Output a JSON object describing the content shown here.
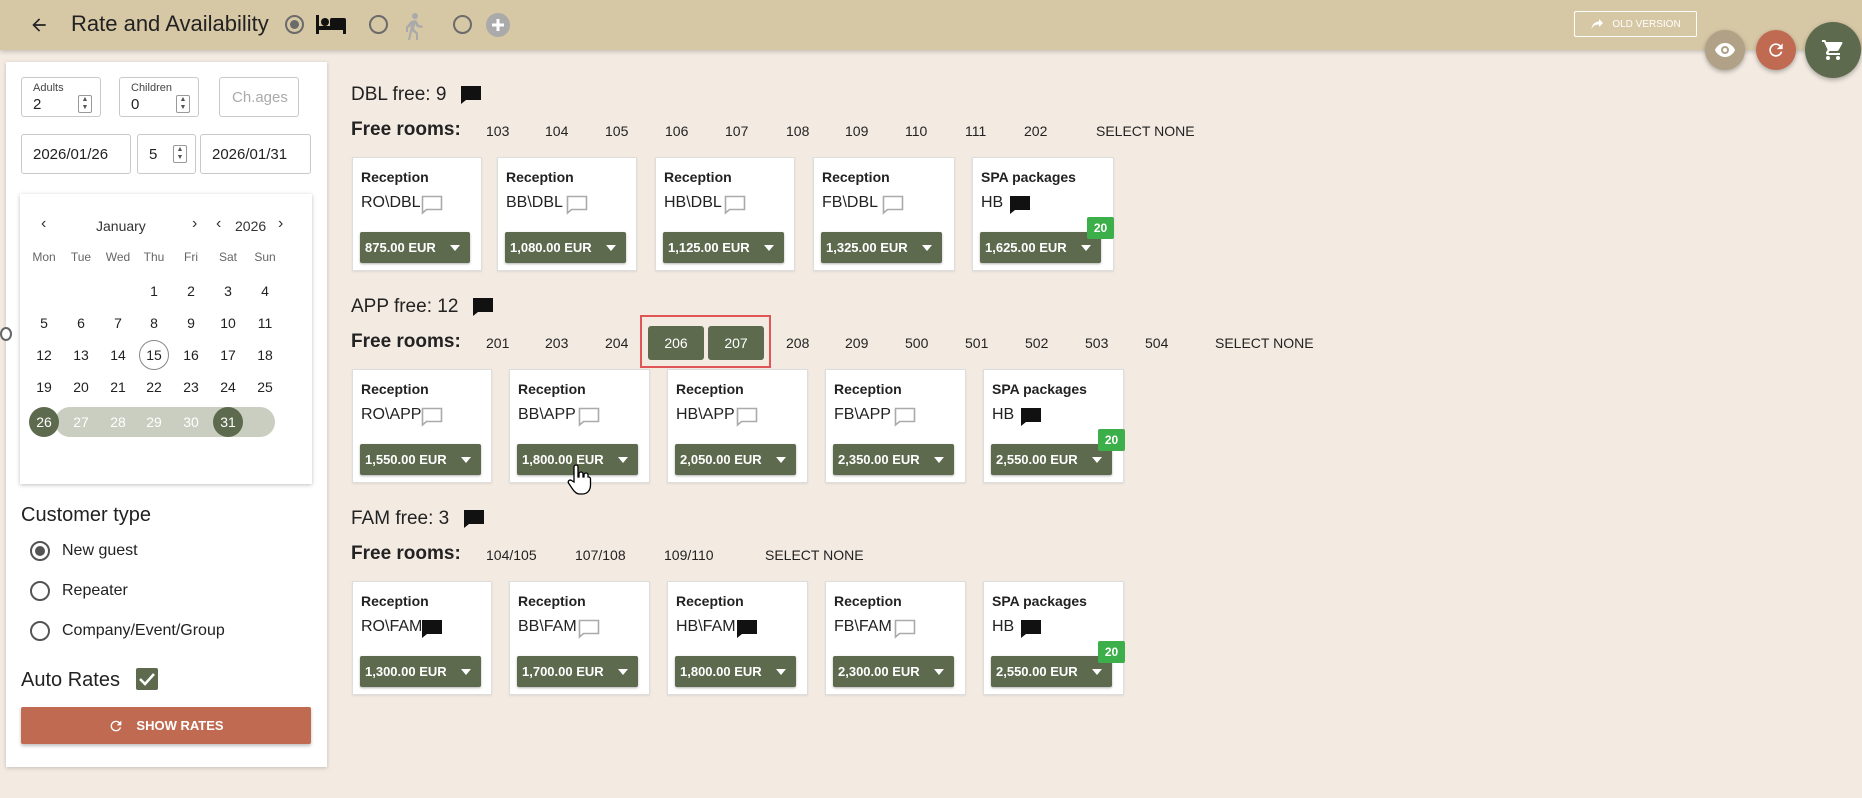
{
  "header": {
    "title": "Rate and Availability",
    "old_version_label": "OLD VERSION"
  },
  "search": {
    "adults_label": "Adults",
    "adults_value": "2",
    "children_label": "Children",
    "children_value": "0",
    "child_ages_placeholder": "Ch.ages",
    "arrival_date": "2026/01/26",
    "nights": "5",
    "departure_date": "2026/01/31"
  },
  "calendar": {
    "month": "January",
    "year": "2026",
    "weekdays": [
      "Mon",
      "Tue",
      "Wed",
      "Thu",
      "Fri",
      "Sat",
      "Sun"
    ],
    "today": "15",
    "range_start": "26",
    "range_end": "31"
  },
  "customer_type": {
    "title": "Customer type",
    "options": [
      "New guest",
      "Repeater",
      "Company/Event/Group"
    ],
    "selected": "New guest"
  },
  "auto_rates": {
    "label": "Auto Rates",
    "checked": true
  },
  "show_rates_label": "SHOW RATES",
  "free_rooms_label": "Free rooms:",
  "select_none_label": "SELECT NONE",
  "groups": [
    {
      "title": "DBL free: 9",
      "rooms": [
        "103",
        "104",
        "105",
        "106",
        "107",
        "108",
        "109",
        "110",
        "111",
        "202"
      ],
      "selected_rooms": [],
      "rates": [
        {
          "category": "Reception",
          "code": "RO\\DBL",
          "price": "875.00 EUR",
          "comment": "empty"
        },
        {
          "category": "Reception",
          "code": "BB\\DBL",
          "price": "1,080.00 EUR",
          "comment": "empty"
        },
        {
          "category": "Reception",
          "code": "HB\\DBL",
          "price": "1,125.00 EUR",
          "comment": "empty"
        },
        {
          "category": "Reception",
          "code": "FB\\DBL",
          "price": "1,325.00 EUR",
          "comment": "empty"
        },
        {
          "category": "SPA packages",
          "code": "HB",
          "price": "1,625.00 EUR",
          "comment": "filled",
          "badge": "20"
        }
      ]
    },
    {
      "title": "APP free: 12",
      "rooms": [
        "201",
        "203",
        "204",
        "206",
        "207",
        "208",
        "209",
        "500",
        "501",
        "502",
        "503",
        "504"
      ],
      "selected_rooms": [
        "206",
        "207"
      ],
      "rates": [
        {
          "category": "Reception",
          "code": "RO\\APP",
          "price": "1,550.00 EUR",
          "comment": "empty"
        },
        {
          "category": "Reception",
          "code": "BB\\APP",
          "price": "1,800.00 EUR",
          "comment": "empty"
        },
        {
          "category": "Reception",
          "code": "HB\\APP",
          "price": "2,050.00 EUR",
          "comment": "empty"
        },
        {
          "category": "Reception",
          "code": "FB\\APP",
          "price": "2,350.00 EUR",
          "comment": "empty"
        },
        {
          "category": "SPA packages",
          "code": "HB",
          "price": "2,550.00 EUR",
          "comment": "filled",
          "badge": "20"
        }
      ]
    },
    {
      "title": "FAM free: 3",
      "rooms": [
        "104/105",
        "107/108",
        "109/110"
      ],
      "selected_rooms": [],
      "rates": [
        {
          "category": "Reception",
          "code": "RO\\FAM",
          "price": "1,300.00 EUR",
          "comment": "filled"
        },
        {
          "category": "Reception",
          "code": "BB\\FAM",
          "price": "1,700.00 EUR",
          "comment": "empty"
        },
        {
          "category": "Reception",
          "code": "HB\\FAM",
          "price": "1,800.00 EUR",
          "comment": "filled"
        },
        {
          "category": "Reception",
          "code": "FB\\FAM",
          "price": "2,300.00 EUR",
          "comment": "empty"
        },
        {
          "category": "SPA packages",
          "code": "HB",
          "price": "2,550.00 EUR",
          "comment": "filled",
          "badge": "20"
        }
      ]
    }
  ],
  "colors": {
    "header_bg": "#d6c7a5",
    "page_bg": "#f3ebe2",
    "primary_olive": "#5d6a4e",
    "accent_terracotta": "#c06a52",
    "badge_green": "#3cae4a",
    "highlight_red": "#e05555"
  }
}
